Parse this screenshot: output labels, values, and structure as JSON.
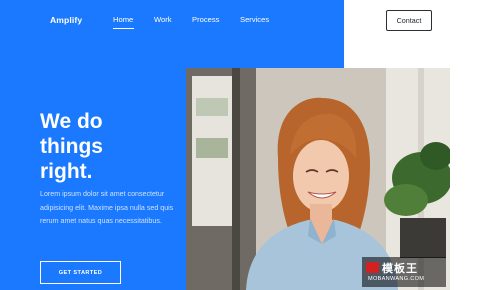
{
  "brand": {
    "logo_text": "Amplify"
  },
  "nav": {
    "items": [
      {
        "label": "Home",
        "active": true
      },
      {
        "label": "Work"
      },
      {
        "label": "Process"
      },
      {
        "label": "Services"
      }
    ]
  },
  "header": {
    "contact_label": "Contact"
  },
  "hero": {
    "headline_line1": "We do",
    "headline_line2": "things",
    "headline_line3": "right.",
    "lead": "Lorem ipsum dolor sit amet consectetur adipisicing elit. Maxime ipsa nulla sed quis rerum amet natus quas necessitatibus.",
    "cta_label": "GET STARTED"
  },
  "watermark": {
    "main": "模板王",
    "sub": "MOBANWANG.COM"
  },
  "colors": {
    "accent": "#1a79ff",
    "text_on_accent": "#ffffff",
    "lead_text": "#cfe2ff"
  }
}
